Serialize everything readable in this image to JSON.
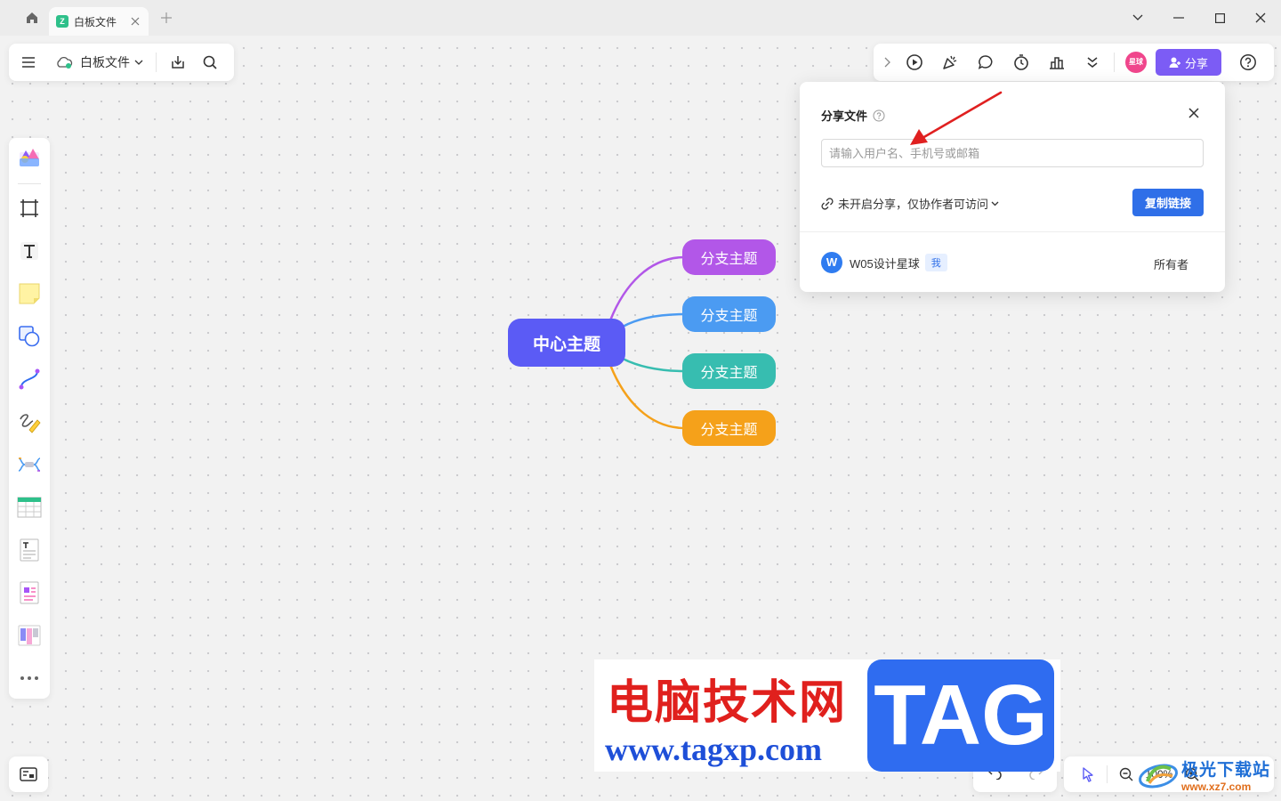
{
  "titlebar": {
    "tab_title": "白板文件",
    "tab_logo_glyph": "Z"
  },
  "top_toolbar": {
    "file_name": "白板文件"
  },
  "right_toolbar": {
    "avatar_badge": "星球",
    "share_label": "分享"
  },
  "share_popup": {
    "title": "分享文件",
    "input_placeholder": "请输入用户名、手机号或邮箱",
    "permission_text": "未开启分享，仅协作者可访问",
    "copy_link_label": "复制链接",
    "member": {
      "avatar_letter": "W",
      "name": "W05设计星球",
      "me_tag": "我",
      "role": "所有者"
    }
  },
  "mindmap": {
    "center": "中心主题",
    "branches": [
      {
        "label": "分支主题",
        "color": "#b257e8"
      },
      {
        "label": "分支主题",
        "color": "#4b9bf2"
      },
      {
        "label": "分支主题",
        "color": "#37bdb0"
      },
      {
        "label": "分支主题",
        "color": "#f5a11a"
      }
    ],
    "center_color": "#5b5bf5"
  },
  "zoom": {
    "value": "100%"
  },
  "watermark": {
    "cn": "电脑技术网",
    "url": "www.tagxp.com",
    "tag": "TAG",
    "site2_cn": "极光下载站",
    "site2_url": "www.xz7.com"
  },
  "colors": {
    "accent": "#7c5cf5",
    "primary_button": "#2f6fe8",
    "annotation_arrow": "#e02020"
  }
}
